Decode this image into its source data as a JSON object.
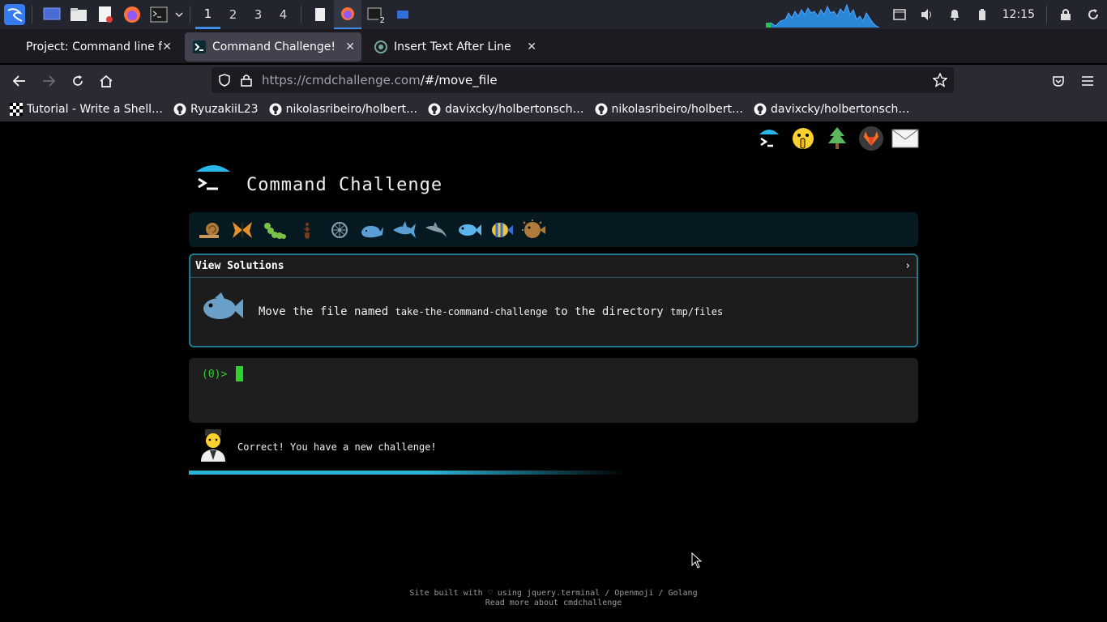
{
  "os_panel": {
    "workspaces": [
      "1",
      "2",
      "3",
      "4"
    ],
    "active_workspace": "1",
    "clock": "12:15",
    "terminal_badge": "2",
    "apps": [
      "kali-menu-icon",
      "desktop-icon",
      "files-icon",
      "text-editor-icon",
      "firefox-icon",
      "terminal-icon"
    ],
    "accent": "#3d8ee8"
  },
  "browser": {
    "tabs": [
      {
        "label": "Project: Command line fo",
        "active": false
      },
      {
        "label": "Command Challenge!",
        "active": true
      },
      {
        "label": "Insert Text After Line",
        "active": false
      }
    ],
    "url_host": "https://cmdchallenge.com",
    "url_path": "/#/move_file",
    "bookmarks": [
      "Tutorial - Write a Shell…",
      "RyuzakiiL23",
      "nikolasribeiro/holbert…",
      "davixcky/holbertonsch…",
      "nikolasribeiro/holbert…",
      "davixcky/holbertonsch…"
    ]
  },
  "page": {
    "site_title": "Command Challenge",
    "view_solutions": "View Solutions",
    "view_solutions_arrow": "›",
    "task": {
      "part1": "Move the file named",
      "file": "take-the-command-challenge",
      "part2": "to the directory",
      "dir": "tmp/files"
    },
    "prompt": "(0)>",
    "status_message": "Correct! You have a new challenge!",
    "progress": 0.55,
    "footer_line1": "Site built with ♡ using jquery.terminal / Openmoji / Golang",
    "footer_line2": "Read more about cmdchallenge",
    "level_icons": [
      "snail-icon",
      "butterfly-icon",
      "caterpillar-icon",
      "ant-icon",
      "wheel-icon",
      "whale-icon",
      "shark-icon",
      "dolphin-icon",
      "fish-icon",
      "tropical-fish-icon",
      "blowfish-icon"
    ],
    "colors": {
      "accent": "#2bb4d6",
      "prompt": "#2fd12f",
      "border": "#1e7a8c"
    }
  }
}
